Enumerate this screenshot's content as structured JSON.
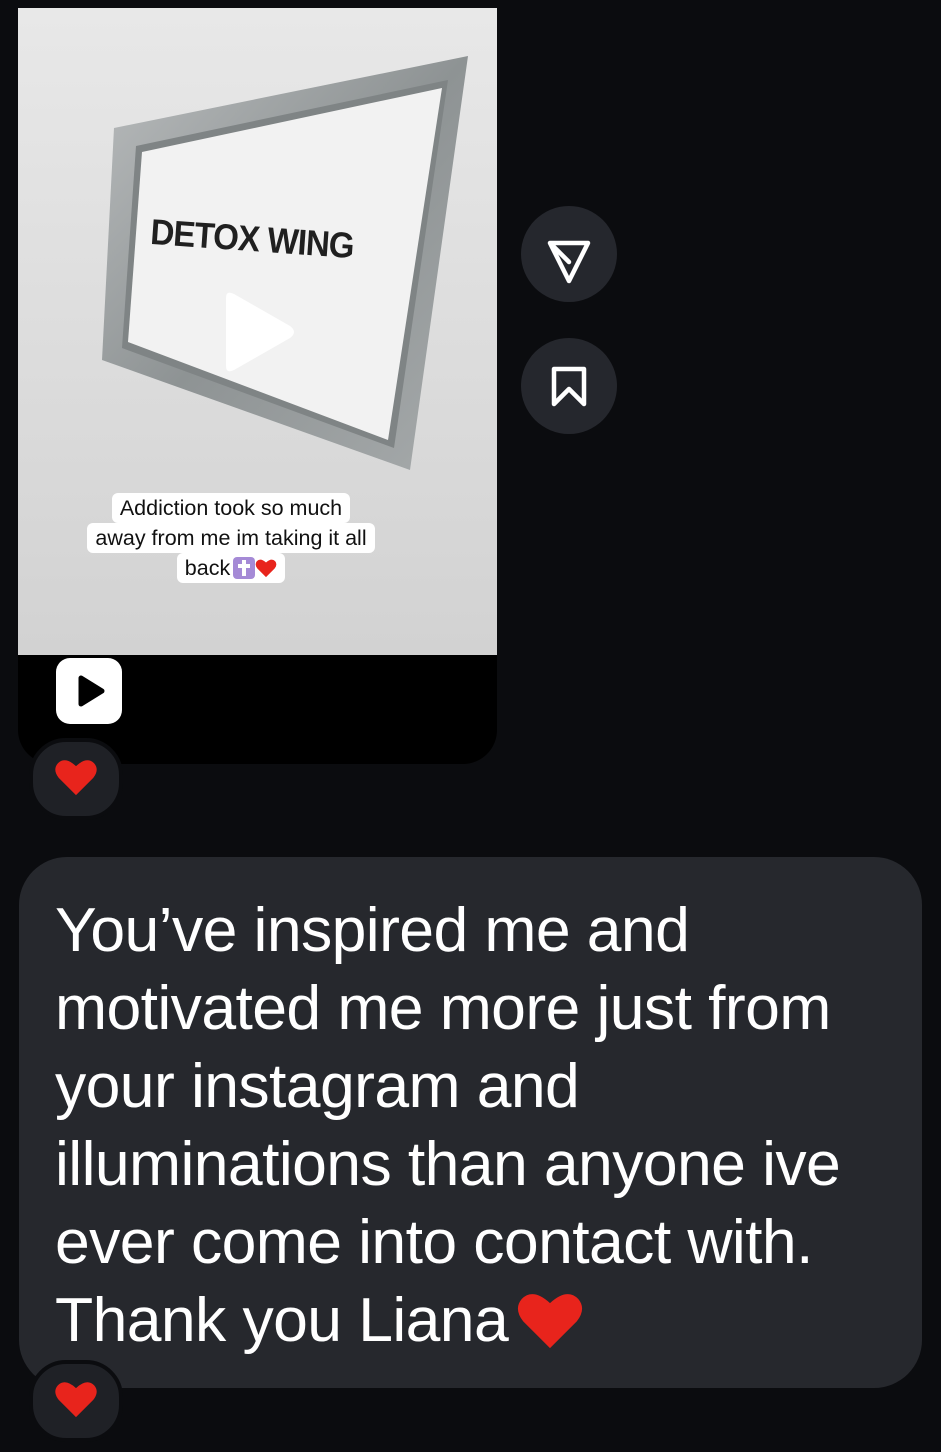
{
  "video_message": {
    "sign_text": "DETOX WING",
    "caption_lines": [
      "Addiction took so much",
      "away from me im taking it all",
      "back"
    ],
    "caption_emojis": [
      "cross-emoji",
      "red-heart-emoji"
    ]
  },
  "actions": {
    "share_icon": "paper-plane-icon",
    "save_icon": "bookmark-icon"
  },
  "reactions": [
    "❤️",
    "❤️"
  ],
  "message": {
    "text": "You’ve inspired me and motivated me more just from your instagram and illuminations than anyone ive ever come into contact with. Thank you Liana",
    "trailing_emoji": "❤️"
  },
  "colors": {
    "background": "#0b0c0f",
    "bubble": "#26282d",
    "action_button": "#25272d",
    "heart": "#e8241c"
  }
}
